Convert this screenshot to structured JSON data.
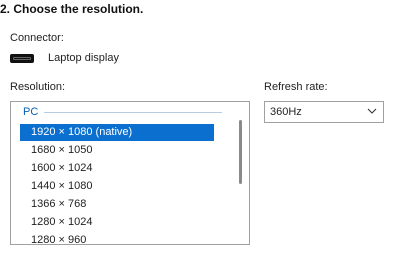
{
  "step_title": "2. Choose the resolution.",
  "connector": {
    "label": "Connector:",
    "value": "Laptop display",
    "icon": "display-icon"
  },
  "resolution": {
    "label": "Resolution:",
    "group": "PC",
    "selected_index": 0,
    "items": [
      "1920 × 1080 (native)",
      "1680 × 1050",
      "1600 × 1024",
      "1440 × 1080",
      "1366 × 768",
      "1280 × 1024",
      "1280 × 960"
    ]
  },
  "refresh": {
    "label": "Refresh rate:",
    "value": "360Hz"
  },
  "colors": {
    "selection": "#0b6fcf",
    "group_header": "#0a5fb0"
  }
}
